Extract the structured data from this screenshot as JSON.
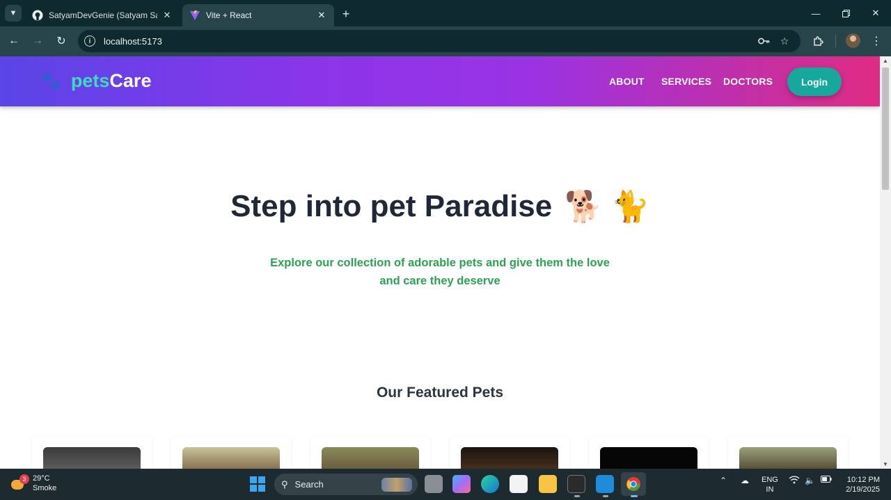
{
  "browser": {
    "tabs": [
      {
        "title": "SatyamDevGenie (Satyam Sawa",
        "active": false
      },
      {
        "title": "Vite + React",
        "active": true
      }
    ],
    "url": "localhost:5173"
  },
  "site": {
    "logo_part1": "pets",
    "logo_part2": "Care",
    "nav": [
      "ABOUT",
      "SERVICES",
      "DOCTORS"
    ],
    "login_label": "Login",
    "hero_title": "Step into pet Paradise",
    "hero_emojis": [
      "🐕",
      "🐈"
    ],
    "hero_subtitle": "Explore our collection of adorable pets and give them the love and care they deserve",
    "featured_title": "Our Featured Pets",
    "card_count": 6
  },
  "colors": {
    "header_start": "#5a45e6",
    "header_end": "#df2c84",
    "logo_accent": "#3dd9c0",
    "login_bg": "#16a79d",
    "subtitle": "#2aa353",
    "title": "#1f2837"
  },
  "taskbar": {
    "weather_badge": "3",
    "temperature": "29°C",
    "weather_desc": "Smoke",
    "search_label": "Search",
    "lang_line1": "ENG",
    "lang_line2": "IN",
    "time": "10:12 PM",
    "date": "2/19/2025"
  }
}
